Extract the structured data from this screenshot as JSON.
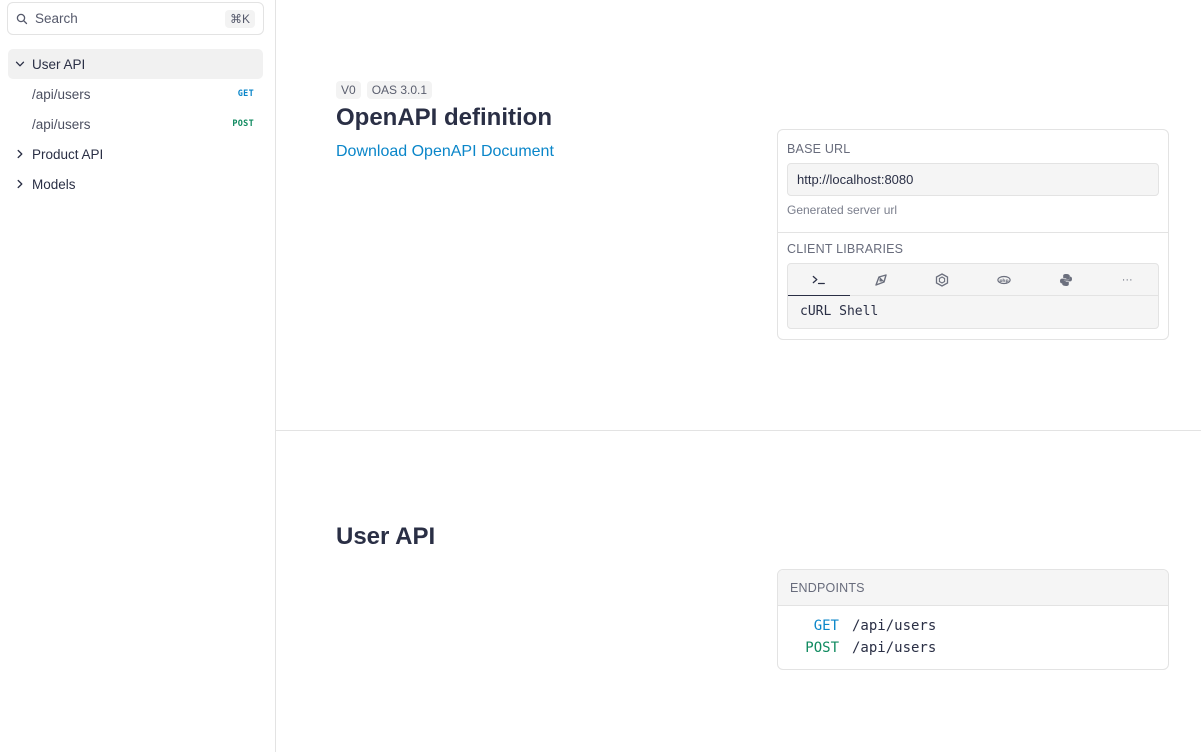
{
  "sidebar": {
    "search": {
      "label": "Search",
      "shortcut": "⌘K",
      "icon": "search-icon"
    },
    "groups": [
      {
        "label": "User API",
        "expanded": true,
        "items": [
          {
            "path": "/api/users",
            "method": "GET"
          },
          {
            "path": "/api/users",
            "method": "POST"
          }
        ]
      },
      {
        "label": "Product API",
        "expanded": false
      },
      {
        "label": "Models",
        "expanded": false
      }
    ]
  },
  "main": {
    "badges": [
      "V0",
      "OAS 3.0.1"
    ],
    "title": "OpenAPI definition",
    "download_link": "Download OpenAPI Document",
    "server_card": {
      "base_url_label": "BASE URL",
      "base_url_value": "http://localhost:8080",
      "base_url_hint": "Generated server url",
      "client_libraries_label": "CLIENT LIBRARIES",
      "tabs": [
        {
          "icon": "terminal-icon",
          "active": true
        },
        {
          "icon": "node-icon",
          "active": false
        },
        {
          "icon": "hexagon-icon",
          "active": false
        },
        {
          "icon": "php-icon",
          "active": false
        },
        {
          "icon": "python-icon",
          "active": false
        },
        {
          "icon": "more-icon",
          "label": "···",
          "active": false
        }
      ],
      "selected_library": "cURL Shell"
    },
    "section": {
      "title": "User API",
      "endpoints_label": "ENDPOINTS",
      "endpoints": [
        {
          "method": "GET",
          "path": "/api/users"
        },
        {
          "method": "POST",
          "path": "/api/users"
        }
      ]
    }
  },
  "colors": {
    "get": "#0a86c9",
    "post": "#0f8a5f",
    "link": "#0a86c9",
    "text": "#2a2f45",
    "border": "#e3e3e3"
  }
}
